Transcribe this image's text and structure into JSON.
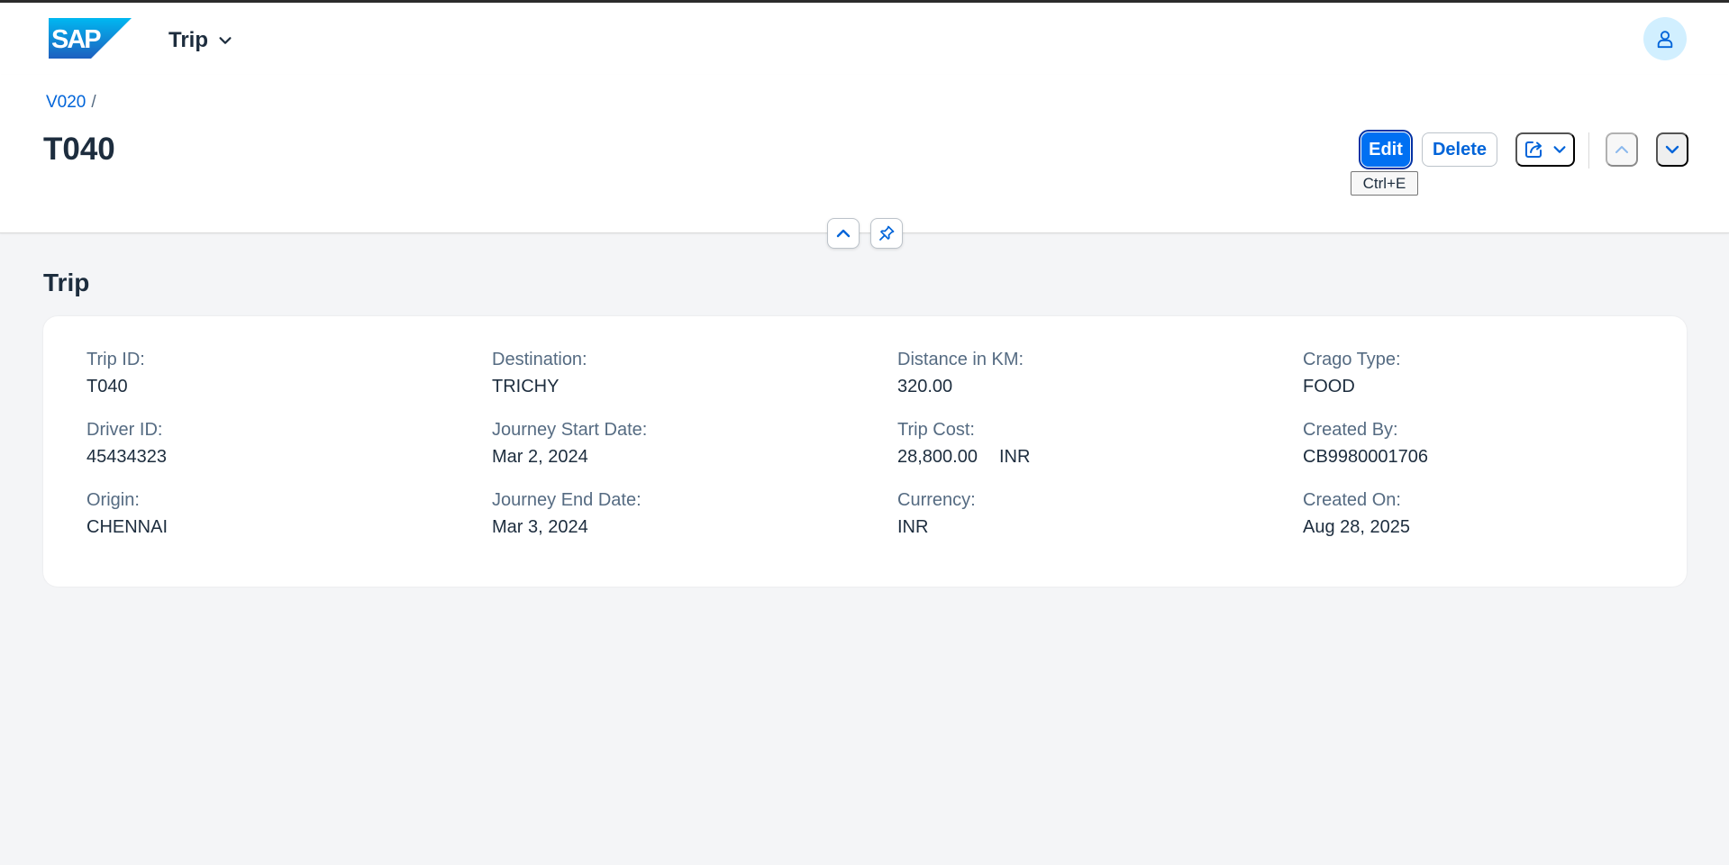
{
  "shell": {
    "logo_text": "SAP",
    "app_title": "Trip",
    "colors": {
      "brand": "#0070f2",
      "logo_blue": "#1873d6",
      "avatar_bg": "#d1efff"
    }
  },
  "header": {
    "breadcrumb": [
      "V020"
    ],
    "breadcrumb_separator": "/",
    "title": "T040",
    "actions": {
      "edit_label": "Edit",
      "delete_label": "Delete"
    },
    "tooltip": "Ctrl+E"
  },
  "section": {
    "title": "Trip",
    "fields": {
      "trip_id": {
        "label": "Trip ID:",
        "value": "T040"
      },
      "driver_id": {
        "label": "Driver ID:",
        "value": "45434323"
      },
      "origin": {
        "label": "Origin:",
        "value": "CHENNAI"
      },
      "destination": {
        "label": "Destination:",
        "value": "TRICHY"
      },
      "journey_start_date": {
        "label": "Journey Start Date:",
        "value": "Mar 2, 2024"
      },
      "journey_end_date": {
        "label": "Journey End Date:",
        "value": "Mar 3, 2024"
      },
      "distance_km": {
        "label": "Distance in KM:",
        "value": "320.00"
      },
      "trip_cost": {
        "label": "Trip Cost:",
        "value": "28,800.00",
        "unit": "INR"
      },
      "currency": {
        "label": "Currency:",
        "value": "INR"
      },
      "cargo_type": {
        "label": "Crago Type:",
        "value": "FOOD"
      },
      "created_by": {
        "label": "Created By:",
        "value": "CB9980001706"
      },
      "created_on": {
        "label": "Created On:",
        "value": "Aug 28, 2025"
      }
    }
  },
  "icons": {
    "app_menu": "chevron-down-icon",
    "avatar": "person-icon",
    "share": "share-icon",
    "share_menu": "chevron-down-icon",
    "previous": "chevron-up-icon",
    "next": "chevron-down-icon",
    "collapse_header": "chevron-up-icon",
    "pin_header": "pin-icon"
  }
}
